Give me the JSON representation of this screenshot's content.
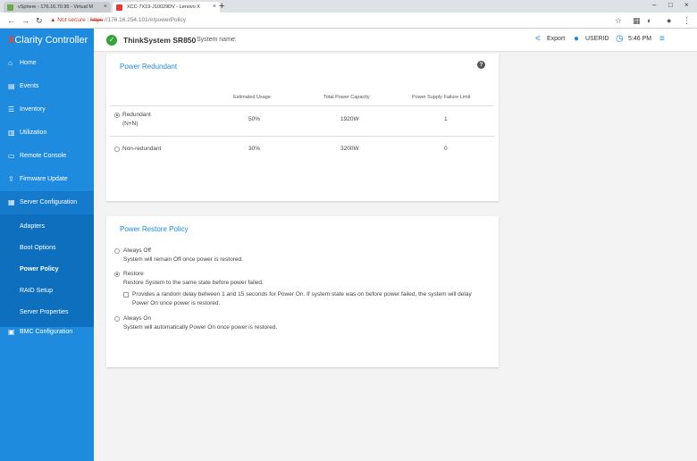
{
  "browser": {
    "tabs": [
      {
        "title": "vSphere - 176.16.70.95 - Virtual M"
      },
      {
        "title": "XCC-7X19-J10029DV - Lenovo X"
      }
    ],
    "url": {
      "security_label": "Not secure",
      "scheme": "https",
      "rest": "://176.16.254.101/#/powerPolicy"
    }
  },
  "header": {
    "brand_x": "X",
    "brand_rest": "Clarity Controller",
    "product_name": "ThinkSystem SR850",
    "system_name_label": "System name:",
    "export_label": "Export",
    "user_label": "USERID",
    "time": "5:46 PM"
  },
  "sidebar": {
    "items": [
      {
        "label": "Home",
        "icon": "home-icon"
      },
      {
        "label": "Events",
        "icon": "events-icon"
      },
      {
        "label": "Inventory",
        "icon": "inventory-icon"
      },
      {
        "label": "Utilization",
        "icon": "utilization-icon"
      },
      {
        "label": "Remote Console",
        "icon": "console-icon"
      },
      {
        "label": "Firmware Update",
        "icon": "upload-icon"
      },
      {
        "label": "Server Configuration",
        "icon": "server-icon"
      },
      {
        "label": "BMC Configuration",
        "icon": "bmc-icon"
      }
    ],
    "sub_items": [
      {
        "label": "Adapters"
      },
      {
        "label": "Boot Options"
      },
      {
        "label": "Power Policy"
      },
      {
        "label": "RAID Setup"
      },
      {
        "label": "Server Properties"
      }
    ]
  },
  "power_redundant": {
    "title": "Power Redundant",
    "columns": [
      "Estimated Usage",
      "Total Power Capacity",
      "Power Supply Failure Limit"
    ],
    "rows": [
      {
        "label_line1": "Redundant",
        "label_line2": "(N+N)",
        "usage": "50%",
        "capacity": "1920W",
        "limit": "1",
        "selected": true
      },
      {
        "label_line1": "Non-redundant",
        "label_line2": "",
        "usage": "30%",
        "capacity": "3200W",
        "limit": "0",
        "selected": false
      }
    ]
  },
  "power_restore": {
    "title": "Power Restore Policy",
    "options": [
      {
        "label": "Always Off",
        "desc": "System will remain Off once power is restored.",
        "selected": false
      },
      {
        "label": "Restore",
        "desc": "Restore System to the same state before power failed.",
        "selected": true
      },
      {
        "label": "Always On",
        "desc": "System will automatically Power On once power is restored.",
        "selected": false
      }
    ],
    "random_delay_line1": "Provides a random delay between 1 and 15 seconds for Power On. If system state was on before power failed, the system will delay",
    "random_delay_line2": "Power On once power is restored."
  },
  "colors": {
    "accent": "#1f8bde",
    "sidebar_sub": "#0f6fbf",
    "brand_x": "#ff3a2f"
  }
}
